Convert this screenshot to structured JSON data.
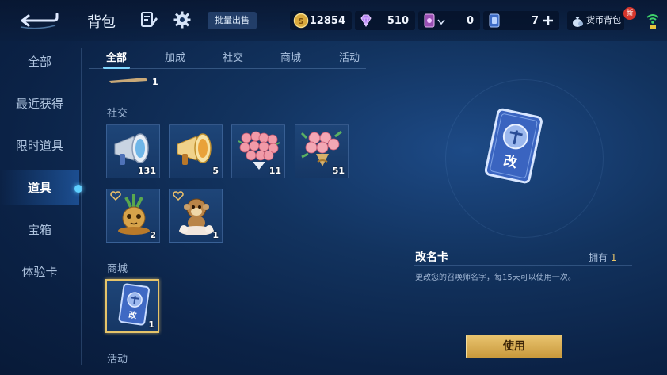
{
  "header": {
    "title": "背包",
    "batch_sell_label": "批量出售",
    "wallet_label": "货币背包",
    "new_badge": "新"
  },
  "currencies": [
    {
      "name": "gold-coin",
      "value": "12854",
      "color": "#e0b64a"
    },
    {
      "name": "diamond",
      "value": "510",
      "color": "#c68cff"
    },
    {
      "name": "ticket-card",
      "value": "0",
      "color": "#d07ad8"
    },
    {
      "name": "voucher-card",
      "value": "7",
      "color": "#7fb2ff"
    }
  ],
  "sidebar": {
    "items": [
      {
        "label": "全部"
      },
      {
        "label": "最近获得"
      },
      {
        "label": "限时道具"
      },
      {
        "label": "道具"
      },
      {
        "label": "宝箱"
      },
      {
        "label": "体验卡"
      }
    ],
    "active_index": 3
  },
  "tabs": [
    {
      "label": "全部"
    },
    {
      "label": "加成"
    },
    {
      "label": "社交"
    },
    {
      "label": "商城"
    },
    {
      "label": "活动"
    }
  ],
  "active_tab": 0,
  "top_partial_item": {
    "count": "1"
  },
  "sections": {
    "social": {
      "label": "社交",
      "items": [
        {
          "icon": "silver-megaphone-icon",
          "count": "131"
        },
        {
          "icon": "gold-megaphone-icon",
          "count": "5"
        },
        {
          "icon": "heart-rose-bouquet-icon",
          "count": "11"
        },
        {
          "icon": "rose-bouquet-icon",
          "count": "51"
        },
        {
          "icon": "pineapple-pet-icon",
          "count": "2"
        },
        {
          "icon": "monkey-pet-icon",
          "count": "1"
        }
      ]
    },
    "mall": {
      "label": "商城",
      "items": [
        {
          "icon": "rename-card-icon",
          "count": "1",
          "glyph": "改"
        }
      ]
    },
    "event": {
      "label": "活动"
    }
  },
  "detail": {
    "name": "改名卡",
    "owned_label": "拥有",
    "owned_count": "1",
    "description": "更改您的召唤师名字，每15天可以使用一次。",
    "card_glyph": "改",
    "use_button": "使用"
  },
  "colors": {
    "accent": "#7fd6ff",
    "gold_button": "#e0b75a",
    "selected_border": "#e6c46a"
  }
}
